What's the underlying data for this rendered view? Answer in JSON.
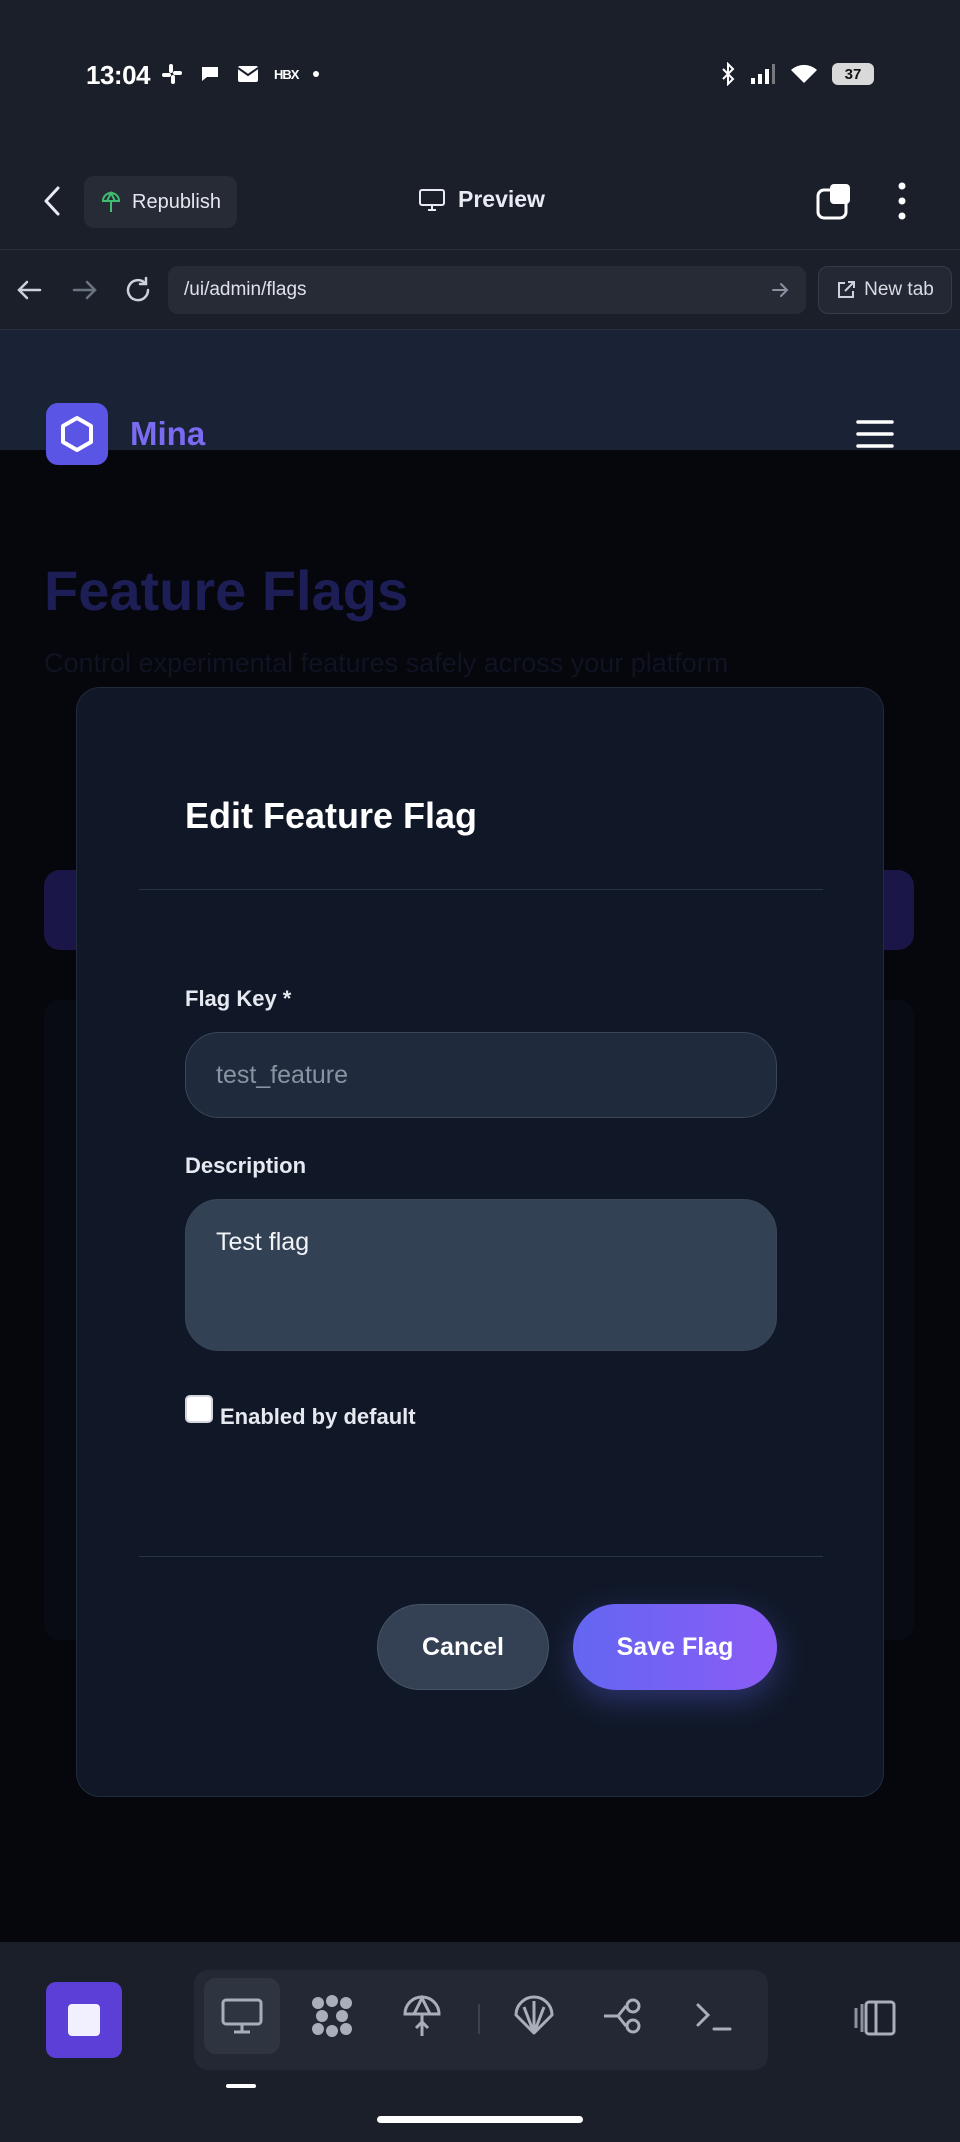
{
  "status_bar": {
    "time": "13:04",
    "notification_icons": [
      "slack-icon",
      "chat-icon",
      "mail-icon",
      "hbx-icon",
      "dot-icon"
    ],
    "hbx_text": "HBX",
    "battery": "37"
  },
  "app_header": {
    "republish_label": "Republish",
    "preview_label": "Preview"
  },
  "url_bar": {
    "url": "/ui/admin/flags",
    "new_tab_label": "New tab"
  },
  "site": {
    "brand": "Mina",
    "page_title": "Feature Flags",
    "page_subtitle": "Control experimental features safely across your platform"
  },
  "modal": {
    "title": "Edit Feature Flag",
    "flag_key_label": "Flag Key *",
    "flag_key_value": "test_feature",
    "description_label": "Description",
    "description_value": "Test flag",
    "enabled_label": "Enabled by default",
    "enabled_checked": false,
    "cancel_label": "Cancel",
    "save_label": "Save Flag"
  },
  "toolbar": {
    "tools": [
      "monitor-icon",
      "grid-dots-icon",
      "umbrella-icon",
      "shell-icon",
      "branch-icon",
      "terminal-icon"
    ],
    "active_tool": "monitor-icon"
  },
  "colors": {
    "accent": "#6366f1",
    "accent_end": "#8b5cf6",
    "brand_purple": "#7b6af2",
    "modal_bg": "#101828"
  }
}
